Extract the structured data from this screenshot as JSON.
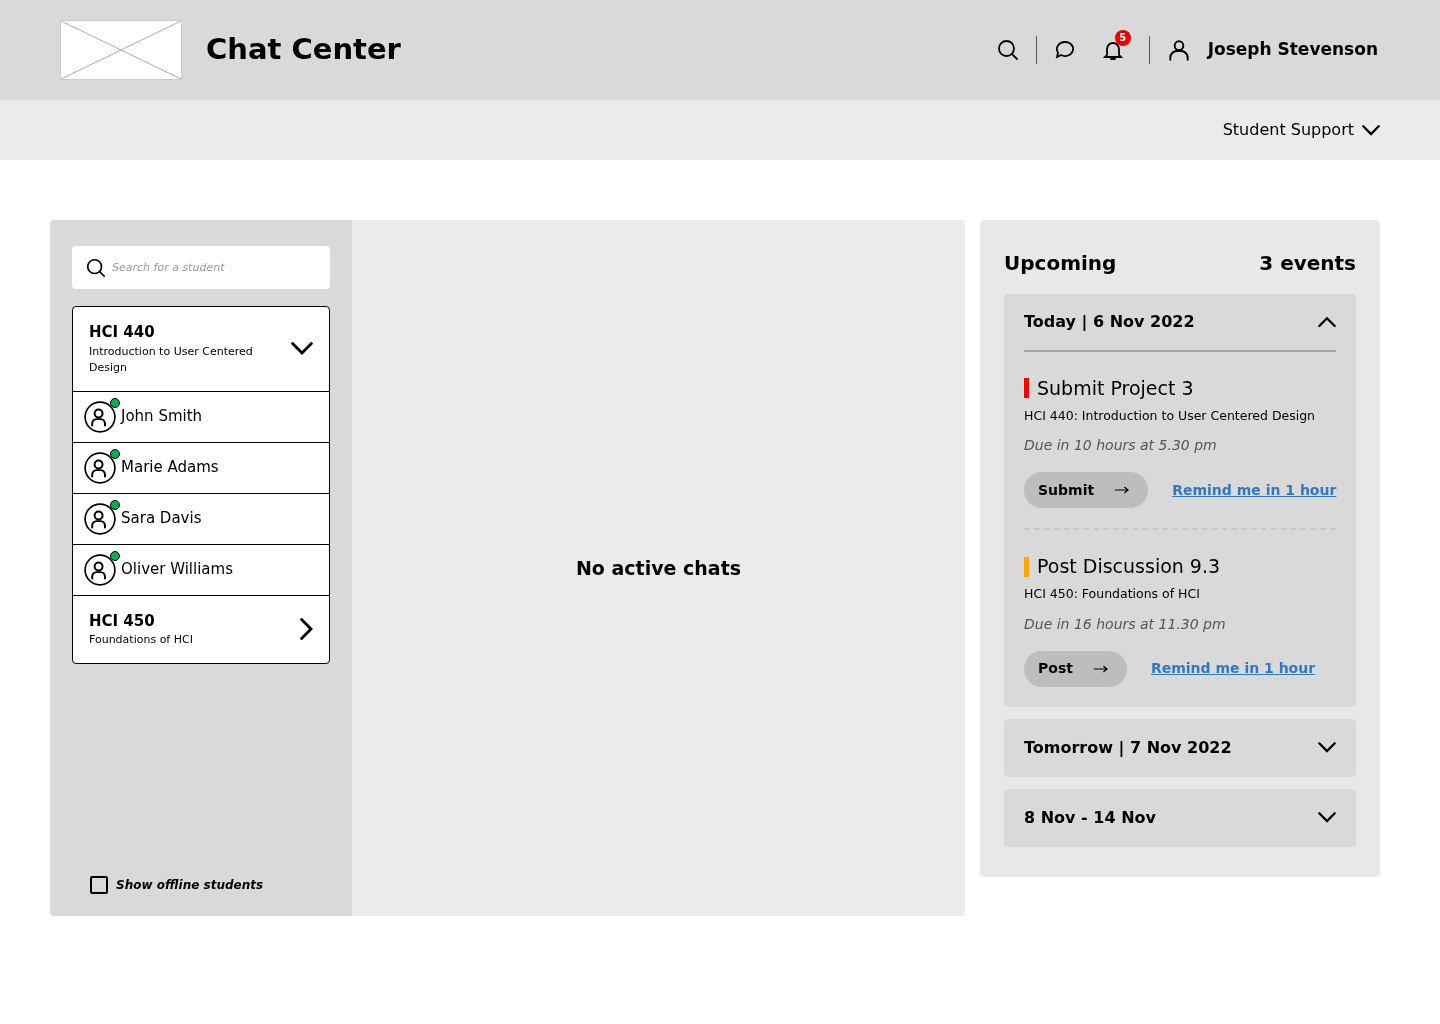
{
  "header": {
    "title": "Chat Center",
    "notification_count": "5",
    "user_name": "Joseph Stevenson"
  },
  "subnav": {
    "dropdown": "Student Support"
  },
  "students_panel": {
    "search": {
      "placeholder": "Search for a student"
    },
    "groups": [
      {
        "code": "HCI 440",
        "name": "Introduction to User Centered Design",
        "expanded": true,
        "students": [
          {
            "name": "John Smith",
            "online": true
          },
          {
            "name": "Marie Adams",
            "online": true
          },
          {
            "name": "Sara Davis",
            "online": true
          },
          {
            "name": "Oliver Williams",
            "online": true
          }
        ]
      },
      {
        "code": "HCI 450",
        "name": "Foundations of HCI",
        "expanded": false
      }
    ],
    "offline_toggle": {
      "label": "Show offline students",
      "checked": false
    }
  },
  "chat": {
    "empty_message": "No active chats"
  },
  "upcoming": {
    "title": "Upcoming",
    "count": "3 events",
    "days": [
      {
        "label": "Today | 6 Nov 2022",
        "expanded": true,
        "events": [
          {
            "title": "Submit Project 3",
            "course": "HCI 440: Introduction to User Centered Design",
            "due": "Due in 10 hours at 5.30 pm",
            "color": "#ff0000",
            "action": "Submit",
            "remind": "Remind me in 1 hour"
          },
          {
            "title": "Post Discussion 9.3",
            "course": "HCI 450: Foundations of HCI",
            "due": "Due in 16 hours at 11.30 pm",
            "color": "#ffa500",
            "action": "Post",
            "remind": "Remind me in 1 hour"
          }
        ]
      },
      {
        "label": "Tomorrow | 7 Nov 2022",
        "expanded": false
      },
      {
        "label": "8 Nov - 14 Nov",
        "expanded": false
      }
    ]
  }
}
